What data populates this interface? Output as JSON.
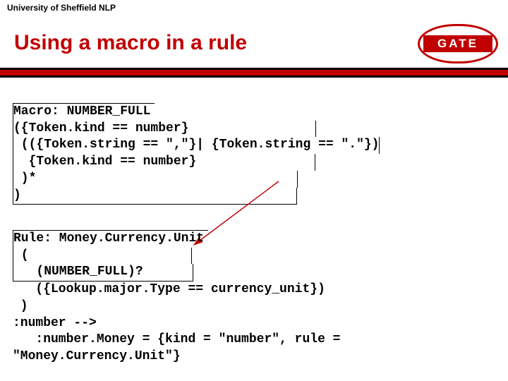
{
  "header": {
    "affiliation": "University of Sheffield NLP"
  },
  "logo": {
    "text": "GATE"
  },
  "title": "Using a macro in a rule",
  "macro": {
    "l1": "Macro: NUMBER_FULL",
    "l2": "({Token.kind == number}",
    "l3": " (({Token.string == \",\"}| {Token.string == \".\"})",
    "l4": "  {Token.kind == number}",
    "l5": " )*",
    "l6": ")"
  },
  "rule": {
    "l1": "Rule: Money.Currency.Unit",
    "l2": " (",
    "l3": "   (NUMBER_FULL)?",
    "l4": "   ({Lookup.major.Type == currency_unit})",
    "l5": " )",
    "l6": ":number -->",
    "l7": "   :number.Money = {kind = \"number\", rule =",
    "l8": "\"Money.Currency.Unit\"}"
  }
}
